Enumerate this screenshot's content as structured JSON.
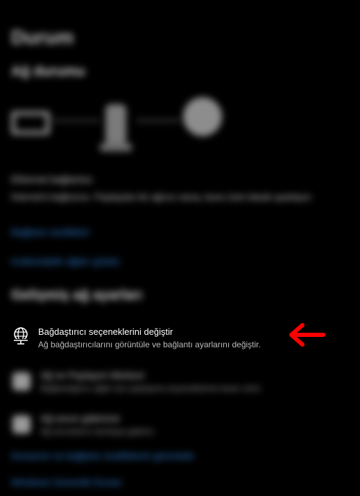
{
  "page": {
    "title": "Durum",
    "subtitle": "Ağ durumu"
  },
  "status": {
    "line1": "Ethernet bağlantısı",
    "line2": "İnternet'e bağlısınız. Paylaşılan bir ağınız varsa, bunu özel olarak ayarlayın."
  },
  "links": {
    "properties": "Bağlantı özellikleri",
    "data_usage": "Kullanılabilir ağları göster"
  },
  "advanced": {
    "heading": "Gelişmiş ağ ayarları"
  },
  "adapter_option": {
    "title": "Bağdaştırıcı seçeneklerini değiştir",
    "description": "Ağ bağdaştırıcılarını görüntüle ve bağlantı ayarlarını değiştir."
  },
  "other_options": [
    {
      "title": "Ağ ve Paylaşım Merkezi",
      "description": "Bağlandığınız ağlar için paylaşma seçeneklerine karar verin."
    },
    {
      "title": "Ağ sorun gidericisi",
      "description": "Ağ sorunlarını tanılayıp giderin."
    }
  ],
  "bottom_links": {
    "hardware": "Donanım ve bağlantı özelliklerini görüntüle",
    "firewall": "Windows Güvenlik Duvarı"
  },
  "colors": {
    "background": "#000000",
    "link": "#2d7fd6",
    "arrow": "#ff0000"
  },
  "icons": {
    "adapter": "network-adapter-icon",
    "arrow": "red-left-arrow-icon"
  }
}
